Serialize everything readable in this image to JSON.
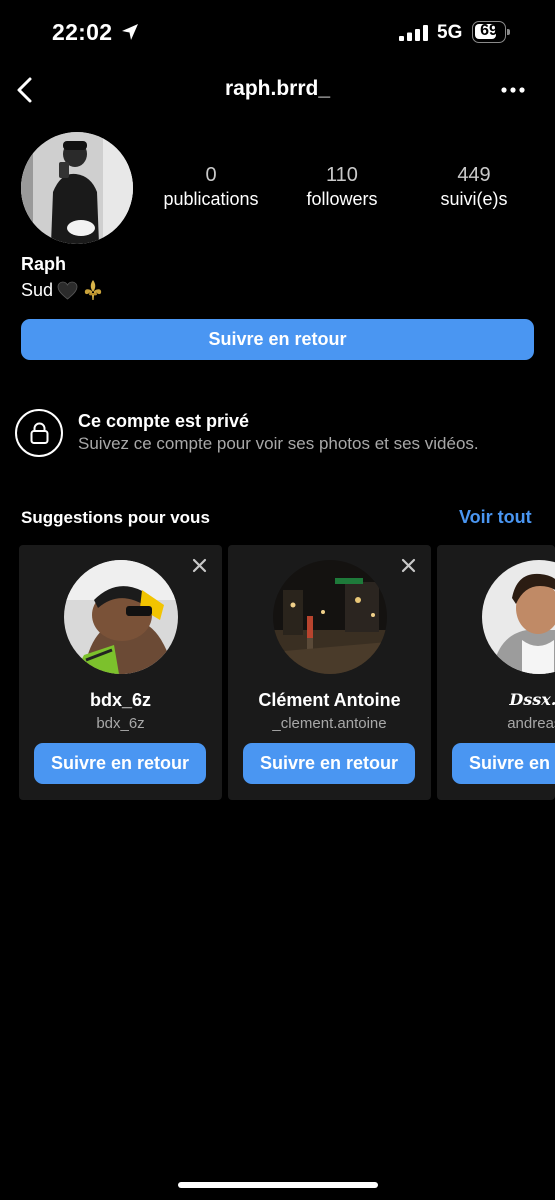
{
  "status_bar": {
    "time": "22:02",
    "network": "5G",
    "battery": "69",
    "battery_level_percent": 69
  },
  "nav": {
    "title": "raph.brrd_"
  },
  "profile": {
    "stats": [
      {
        "number": "0",
        "label": "publications"
      },
      {
        "number": "110",
        "label": "followers"
      },
      {
        "number": "449",
        "label": "suivi(e)s"
      }
    ],
    "name": "Raph",
    "bio_text": "Sud",
    "follow_back_label": "Suivre en retour"
  },
  "private": {
    "title": "Ce compte est privé",
    "description": "Suivez ce compte pour voir ses photos et ses vidéos."
  },
  "suggestions": {
    "title": "Suggestions pour vous",
    "see_all": "Voir tout",
    "cards": [
      {
        "name": "bdx_6z",
        "username": "bdx_6z",
        "button": "Suivre en retour"
      },
      {
        "name": "Clément Antoine",
        "username": "_clement.antoine",
        "button": "Suivre en retour"
      },
      {
        "name": "Dssx.p",
        "username": "andreas_",
        "button": "Suivre en retour"
      }
    ]
  },
  "colors": {
    "accent": "#4a96f2",
    "background": "#000000",
    "card": "#1a1a1a",
    "secondary_text": "#a8a8a8"
  }
}
